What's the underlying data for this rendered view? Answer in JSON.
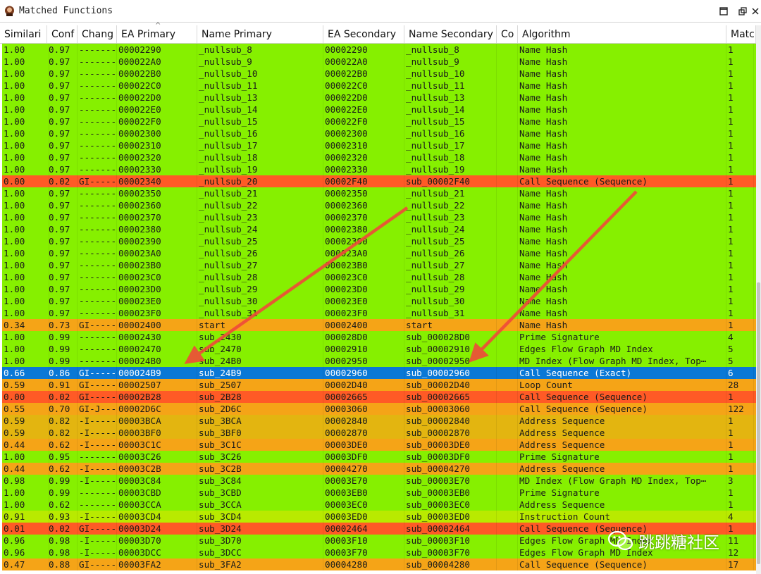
{
  "window": {
    "title": "Matched Functions"
  },
  "colors": {
    "green": "#86f000",
    "lime": "#b9ea00",
    "red": "#ff5a26",
    "orange": "#f5a417",
    "amber": "#e3b510",
    "selected": "#0a78d6"
  },
  "columns": [
    "Similari",
    "Conf",
    "Chang",
    "EA Primary",
    "Name Primary",
    "EA Secondary",
    "Name Secondary",
    "Co",
    "Algorithm",
    "Matc"
  ],
  "rows": [
    {
      "c": [
        "1.00",
        "0.97",
        "-------⋯",
        "00002290",
        "_nullsub_8",
        "00002290",
        "_nullsub_8",
        "",
        "Name Hash",
        "1"
      ],
      "color": "green"
    },
    {
      "c": [
        "1.00",
        "0.97",
        "-------⋯",
        "000022A0",
        "_nullsub_9",
        "000022A0",
        "_nullsub_9",
        "",
        "Name Hash",
        "1"
      ],
      "color": "green"
    },
    {
      "c": [
        "1.00",
        "0.97",
        "-------⋯",
        "000022B0",
        "_nullsub_10",
        "000022B0",
        "_nullsub_10",
        "",
        "Name Hash",
        "1"
      ],
      "color": "green"
    },
    {
      "c": [
        "1.00",
        "0.97",
        "-------⋯",
        "000022C0",
        "_nullsub_11",
        "000022C0",
        "_nullsub_11",
        "",
        "Name Hash",
        "1"
      ],
      "color": "green"
    },
    {
      "c": [
        "1.00",
        "0.97",
        "-------⋯",
        "000022D0",
        "_nullsub_13",
        "000022D0",
        "_nullsub_13",
        "",
        "Name Hash",
        "1"
      ],
      "color": "green"
    },
    {
      "c": [
        "1.00",
        "0.97",
        "-------⋯",
        "000022E0",
        "_nullsub_14",
        "000022E0",
        "_nullsub_14",
        "",
        "Name Hash",
        "1"
      ],
      "color": "green"
    },
    {
      "c": [
        "1.00",
        "0.97",
        "-------⋯",
        "000022F0",
        "_nullsub_15",
        "000022F0",
        "_nullsub_15",
        "",
        "Name Hash",
        "1"
      ],
      "color": "green"
    },
    {
      "c": [
        "1.00",
        "0.97",
        "-------⋯",
        "00002300",
        "_nullsub_16",
        "00002300",
        "_nullsub_16",
        "",
        "Name Hash",
        "1"
      ],
      "color": "green"
    },
    {
      "c": [
        "1.00",
        "0.97",
        "-------⋯",
        "00002310",
        "_nullsub_17",
        "00002310",
        "_nullsub_17",
        "",
        "Name Hash",
        "1"
      ],
      "color": "green"
    },
    {
      "c": [
        "1.00",
        "0.97",
        "-------⋯",
        "00002320",
        "_nullsub_18",
        "00002320",
        "_nullsub_18",
        "",
        "Name Hash",
        "1"
      ],
      "color": "green"
    },
    {
      "c": [
        "1.00",
        "0.97",
        "-------⋯",
        "00002330",
        "_nullsub_19",
        "00002330",
        "_nullsub_19",
        "",
        "Name Hash",
        "1"
      ],
      "color": "green"
    },
    {
      "c": [
        "0.00",
        "0.02",
        "GI-----⋯",
        "00002340",
        "_nullsub_20",
        "00002F40",
        "sub_00002F40",
        "",
        "Call Sequence (Sequence)",
        "1"
      ],
      "color": "red"
    },
    {
      "c": [
        "1.00",
        "0.97",
        "-------⋯",
        "00002350",
        "_nullsub_21",
        "00002350",
        "_nullsub_21",
        "",
        "Name Hash",
        "1"
      ],
      "color": "green"
    },
    {
      "c": [
        "1.00",
        "0.97",
        "-------⋯",
        "00002360",
        "_nullsub_22",
        "00002360",
        "_nullsub_22",
        "",
        "Name Hash",
        "1"
      ],
      "color": "green"
    },
    {
      "c": [
        "1.00",
        "0.97",
        "-------⋯",
        "00002370",
        "_nullsub_23",
        "00002370",
        "_nullsub_23",
        "",
        "Name Hash",
        "1"
      ],
      "color": "green"
    },
    {
      "c": [
        "1.00",
        "0.97",
        "-------⋯",
        "00002380",
        "_nullsub_24",
        "00002380",
        "_nullsub_24",
        "",
        "Name Hash",
        "1"
      ],
      "color": "green"
    },
    {
      "c": [
        "1.00",
        "0.97",
        "-------⋯",
        "00002390",
        "_nullsub_25",
        "00002390",
        "_nullsub_25",
        "",
        "Name Hash",
        "1"
      ],
      "color": "green"
    },
    {
      "c": [
        "1.00",
        "0.97",
        "-------⋯",
        "000023A0",
        "_nullsub_26",
        "000023A0",
        "_nullsub_26",
        "",
        "Name Hash",
        "1"
      ],
      "color": "green"
    },
    {
      "c": [
        "1.00",
        "0.97",
        "-------⋯",
        "000023B0",
        "_nullsub_27",
        "000023B0",
        "_nullsub_27",
        "",
        "Name Hash",
        "1"
      ],
      "color": "green"
    },
    {
      "c": [
        "1.00",
        "0.97",
        "-------⋯",
        "000023C0",
        "_nullsub_28",
        "000023C0",
        "_nullsub_28",
        "",
        "Name Hash",
        "1"
      ],
      "color": "green"
    },
    {
      "c": [
        "1.00",
        "0.97",
        "-------⋯",
        "000023D0",
        "_nullsub_29",
        "000023D0",
        "_nullsub_29",
        "",
        "Name Hash",
        "1"
      ],
      "color": "green"
    },
    {
      "c": [
        "1.00",
        "0.97",
        "-------⋯",
        "000023E0",
        "_nullsub_30",
        "000023E0",
        "_nullsub_30",
        "",
        "Name Hash",
        "1"
      ],
      "color": "green"
    },
    {
      "c": [
        "1.00",
        "0.97",
        "-------⋯",
        "000023F0",
        "_nullsub_31",
        "000023F0",
        "_nullsub_31",
        "",
        "Name Hash",
        "1"
      ],
      "color": "green"
    },
    {
      "c": [
        "0.34",
        "0.73",
        "GI-----⋯",
        "00002400",
        "start",
        "00002400",
        "start",
        "",
        "Name Hash",
        "1"
      ],
      "color": "orange"
    },
    {
      "c": [
        "1.00",
        "0.99",
        "-------⋯",
        "00002430",
        "sub_2430",
        "000028D0",
        "sub_000028D0",
        "",
        "Prime Signature",
        "4"
      ],
      "color": "green"
    },
    {
      "c": [
        "1.00",
        "0.99",
        "-------⋯",
        "00002470",
        "sub_2470",
        "00002910",
        "sub_00002910",
        "",
        "Edges Flow Graph MD Index",
        "5"
      ],
      "color": "green"
    },
    {
      "c": [
        "1.00",
        "0.99",
        "-------⋯",
        "000024B0",
        "sub_24B0",
        "00002950",
        "sub_00002950",
        "",
        "MD Index (Flow Graph MD Index, Top⋯",
        "5"
      ],
      "color": "green"
    },
    {
      "c": [
        "0.66",
        "0.86",
        "GI-----⋯",
        "000024B9",
        "sub_24B9",
        "00002960",
        "sub_00002960",
        "",
        "Call Sequence (Exact)",
        "6"
      ],
      "color": "selected"
    },
    {
      "c": [
        "0.59",
        "0.91",
        "GI-----⋯",
        "00002507",
        "sub_2507",
        "00002D40",
        "sub_00002D40",
        "",
        "Loop Count",
        "28"
      ],
      "color": "orange"
    },
    {
      "c": [
        "0.00",
        "0.02",
        "GI-----⋯",
        "00002B28",
        "sub_2B28",
        "00002665",
        "sub_00002665",
        "",
        "Call Sequence (Sequence)",
        "1"
      ],
      "color": "red"
    },
    {
      "c": [
        "0.55",
        "0.70",
        "GI-J---⋯",
        "00002D6C",
        "sub_2D6C",
        "00003060",
        "sub_00003060",
        "",
        "Call Sequence (Sequence)",
        "122"
      ],
      "color": "orange"
    },
    {
      "c": [
        "0.59",
        "0.82",
        "-I-----⋯",
        "00003BCA",
        "sub_3BCA",
        "00002840",
        "sub_00002840",
        "",
        "Address Sequence",
        "1"
      ],
      "color": "amber"
    },
    {
      "c": [
        "0.59",
        "0.82",
        "-I-----⋯",
        "00003BF0",
        "sub_3BF0",
        "00002870",
        "sub_00002870",
        "",
        "Address Sequence",
        "1"
      ],
      "color": "amber"
    },
    {
      "c": [
        "0.44",
        "0.62",
        "-I-----⋯",
        "00003C1C",
        "sub_3C1C",
        "00003DE0",
        "sub_00003DE0",
        "",
        "Address Sequence",
        "1"
      ],
      "color": "orange"
    },
    {
      "c": [
        "1.00",
        "0.95",
        "-------⋯",
        "00003C26",
        "sub_3C26",
        "00003DF0",
        "sub_00003DF0",
        "",
        "Prime Signature",
        "1"
      ],
      "color": "green"
    },
    {
      "c": [
        "0.44",
        "0.62",
        "-I-----⋯",
        "00003C2B",
        "sub_3C2B",
        "00004270",
        "sub_00004270",
        "",
        "Address Sequence",
        "1"
      ],
      "color": "orange"
    },
    {
      "c": [
        "0.98",
        "0.99",
        "-I-----⋯",
        "00003C84",
        "sub_3C84",
        "00003E70",
        "sub_00003E70",
        "",
        "MD Index (Flow Graph MD Index, Top⋯",
        "3"
      ],
      "color": "green"
    },
    {
      "c": [
        "1.00",
        "0.99",
        "-------⋯",
        "00003CBD",
        "sub_3CBD",
        "00003EB0",
        "sub_00003EB0",
        "",
        "Prime Signature",
        "1"
      ],
      "color": "green"
    },
    {
      "c": [
        "1.00",
        "0.62",
        "-------⋯",
        "00003CCA",
        "sub_3CCA",
        "00003EC0",
        "sub_00003EC0",
        "",
        "Address Sequence",
        "1"
      ],
      "color": "green"
    },
    {
      "c": [
        "0.91",
        "0.93",
        "-I-----⋯",
        "00003CD4",
        "sub_3CD4",
        "00003ED0",
        "sub_00003ED0",
        "",
        "Instruction Count",
        "4"
      ],
      "color": "lime"
    },
    {
      "c": [
        "0.01",
        "0.02",
        "GI-----⋯",
        "00003D24",
        "sub_3D24",
        "00002464",
        "sub_00002464",
        "",
        "Call Sequence (Sequence)",
        "1"
      ],
      "color": "red"
    },
    {
      "c": [
        "0.96",
        "0.98",
        "-I-----⋯",
        "00003D70",
        "sub_3D70",
        "00003F10",
        "sub_00003F10",
        "",
        "Edges Flow Graph MD Index",
        "11"
      ],
      "color": "green"
    },
    {
      "c": [
        "0.96",
        "0.98",
        "-I-----⋯",
        "00003DCC",
        "sub_3DCC",
        "00003F70",
        "sub_00003F70",
        "",
        "Edges Flow Graph MD Index",
        "12"
      ],
      "color": "green"
    },
    {
      "c": [
        "0.47",
        "0.88",
        "GI-----⋯",
        "00003FA2",
        "sub_3FA2",
        "00004280",
        "sub_00004280",
        "",
        "Call Sequence (Sequence)",
        "17"
      ],
      "color": "orange"
    }
  ],
  "watermark": {
    "text": "跳跳糖社区"
  }
}
